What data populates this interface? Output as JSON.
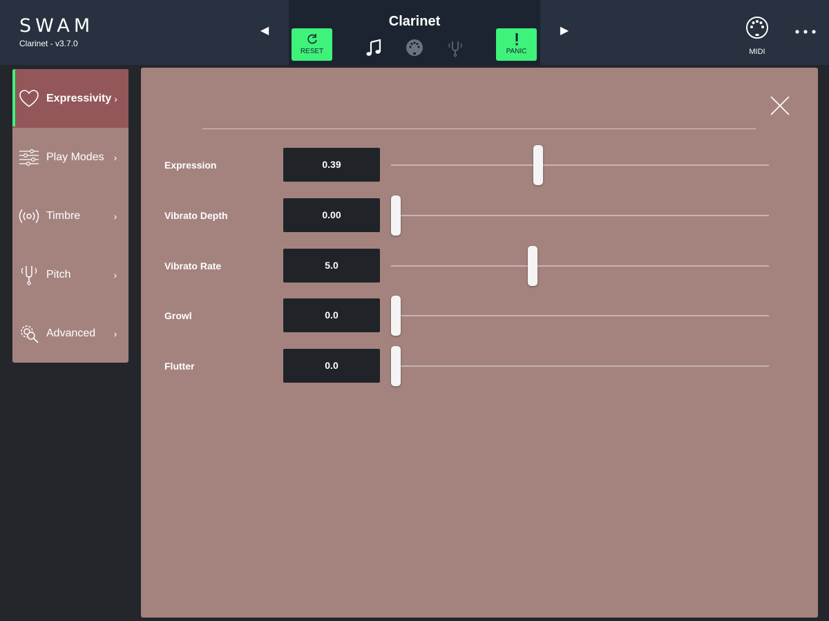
{
  "header": {
    "brand": "SWAM",
    "version": "Clarinet - v3.7.0",
    "instrument": "Clarinet",
    "reset_label": "RESET",
    "panic_label": "PANIC",
    "midi_label": "MIDI",
    "prev_arrow": "◀",
    "next_arrow": "▶",
    "accent_color": "#3ef27a"
  },
  "sidebar": {
    "items": [
      {
        "label": "Expressivity",
        "icon": "heart-icon",
        "active": true
      },
      {
        "label": "Play Modes",
        "icon": "sliders-icon",
        "active": false
      },
      {
        "label": "Timbre",
        "icon": "broadcast-icon",
        "active": false
      },
      {
        "label": "Pitch",
        "icon": "tuning-fork-icon",
        "active": false
      },
      {
        "label": "Advanced",
        "icon": "advanced-gear-icon",
        "active": false
      }
    ],
    "chevron": "›"
  },
  "params": [
    {
      "label": "Expression",
      "value": "0.39",
      "level": 0.39
    },
    {
      "label": "Vibrato Depth",
      "value": "0.00",
      "level": 0.0
    },
    {
      "label": "Vibrato Rate",
      "value": "5.0",
      "level": 0.375
    },
    {
      "label": "Growl",
      "value": "0.0",
      "level": 0.0
    },
    {
      "label": "Flutter",
      "value": "0.0",
      "level": 0.0
    }
  ]
}
